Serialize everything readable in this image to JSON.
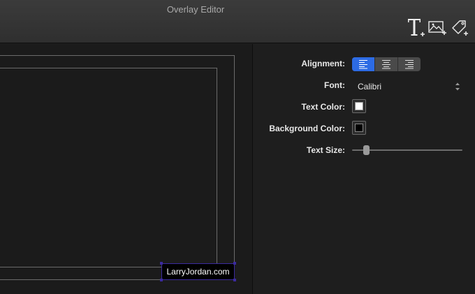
{
  "window": {
    "title": "Overlay Editor"
  },
  "toolbar": {
    "items": [
      {
        "id": "add-text",
        "icon": "text-add-icon"
      },
      {
        "id": "add-image",
        "icon": "image-add-icon"
      },
      {
        "id": "add-tag",
        "icon": "tag-add-icon"
      }
    ]
  },
  "canvas": {
    "watermark_text": "LarryJordan.com",
    "watermark_color": "#3b2a9e"
  },
  "inspector": {
    "alignment": {
      "label": "Alignment:",
      "options": [
        "left",
        "center",
        "right"
      ],
      "selected": "left",
      "accent": "#2d6be4"
    },
    "font": {
      "label": "Font:",
      "value": "Calibri"
    },
    "text_color": {
      "label": "Text  Color:",
      "value": "#ffffff"
    },
    "background_color": {
      "label": "Background Color:",
      "value": "#000000"
    },
    "text_size": {
      "label": "Text Size:",
      "fraction": 0.11
    }
  }
}
